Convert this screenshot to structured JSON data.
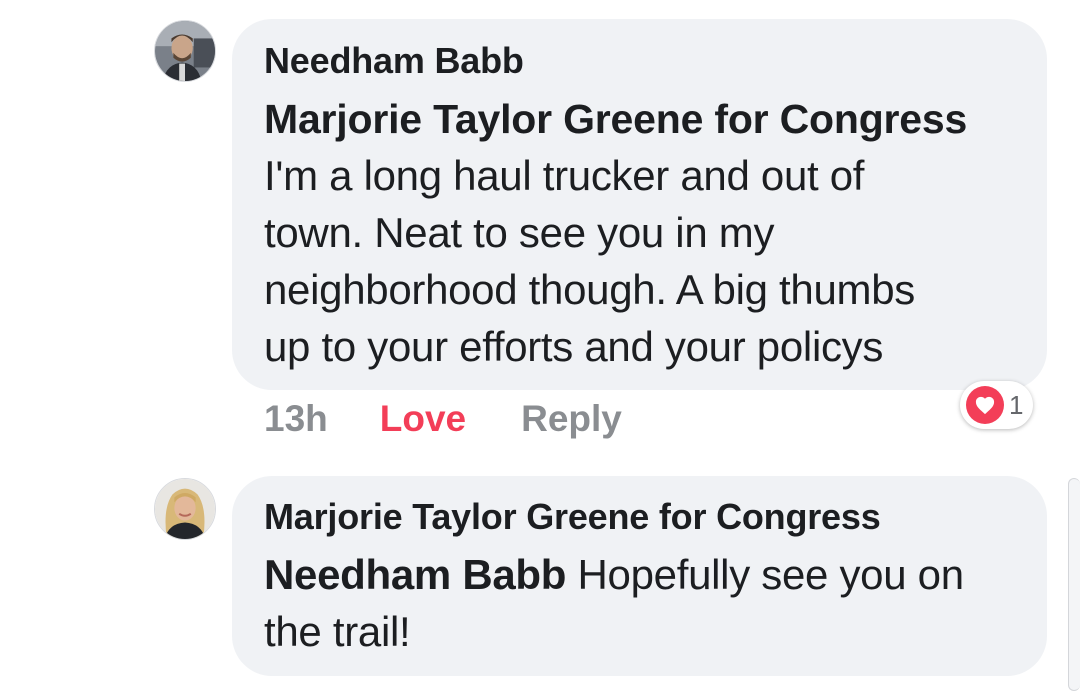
{
  "comment": {
    "author": "Needham Babb",
    "mention": "Marjorie Taylor Greene for Congress",
    "text_lines": [
      "I'm a long haul trucker and out of",
      "town. Neat to see you in my",
      "neighborhood though. A big thumbs",
      "up to your efforts and your policys"
    ],
    "time": "13h",
    "love_label": "Love",
    "reply_label": "Reply",
    "reaction_count": "1",
    "reaction_icon": "heart-icon"
  },
  "reply": {
    "author": "Marjorie Taylor Greene for Congress",
    "mention": "Needham Babb",
    "text_after_mention": " Hopefully see you on",
    "text_line2": "the trail!"
  },
  "colors": {
    "bubble": "#f0f2f5",
    "love": "#f33e58",
    "meta": "#8a8d91"
  }
}
